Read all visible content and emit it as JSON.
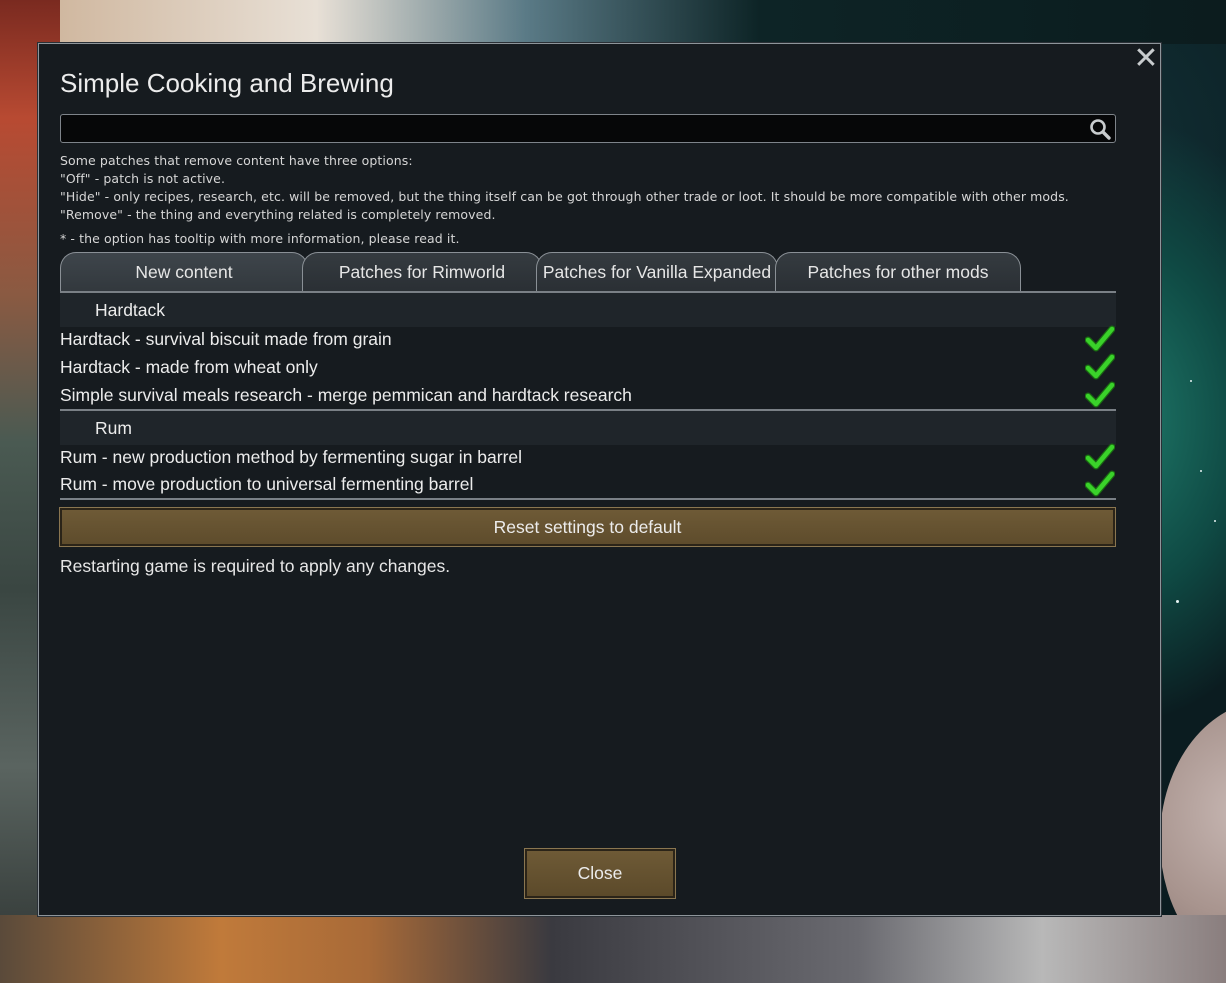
{
  "dialog": {
    "title": "Simple Cooking and Brewing",
    "close_icon": "close-x-icon"
  },
  "search": {
    "value": "",
    "placeholder": "",
    "icon": "search-icon"
  },
  "description": {
    "lines": [
      "Some patches that remove content have three options:",
      "\"Off\" - patch is not active.",
      "\"Hide\" - only recipes, research, etc. will be removed, but the thing itself can be got through other trade or loot. It should be more compatible with other mods.",
      "\"Remove\" - the thing and everything related is completely removed."
    ],
    "tooltip_note": "* - the option has tooltip with more information, please read it."
  },
  "tabs": [
    {
      "label": "New content",
      "active": true
    },
    {
      "label": "Patches for Rimworld",
      "active": false
    },
    {
      "label": "Patches for Vanilla Expanded",
      "active": false
    },
    {
      "label": "Patches for other mods",
      "active": false
    }
  ],
  "sections": [
    {
      "header": "Hardtack",
      "options": [
        {
          "label": "Hardtack - survival biscuit made from grain",
          "checked": true
        },
        {
          "label": "Hardtack - made from wheat only",
          "checked": true
        },
        {
          "label": "Simple survival meals research - merge pemmican and hardtack research",
          "checked": true
        }
      ]
    },
    {
      "header": "Rum",
      "options": [
        {
          "label": "Rum - new production method by fermenting sugar in barrel",
          "checked": true
        },
        {
          "label": "Rum - move production to universal fermenting barrel",
          "checked": true
        }
      ]
    }
  ],
  "reset_button": "Reset settings to default",
  "restart_note": "Restarting game is required to apply any changes.",
  "close_button": "Close",
  "colors": {
    "dialog_bg": "#161b1f",
    "button_brown": "#6e5a36",
    "check_green": "#3ad22a"
  }
}
